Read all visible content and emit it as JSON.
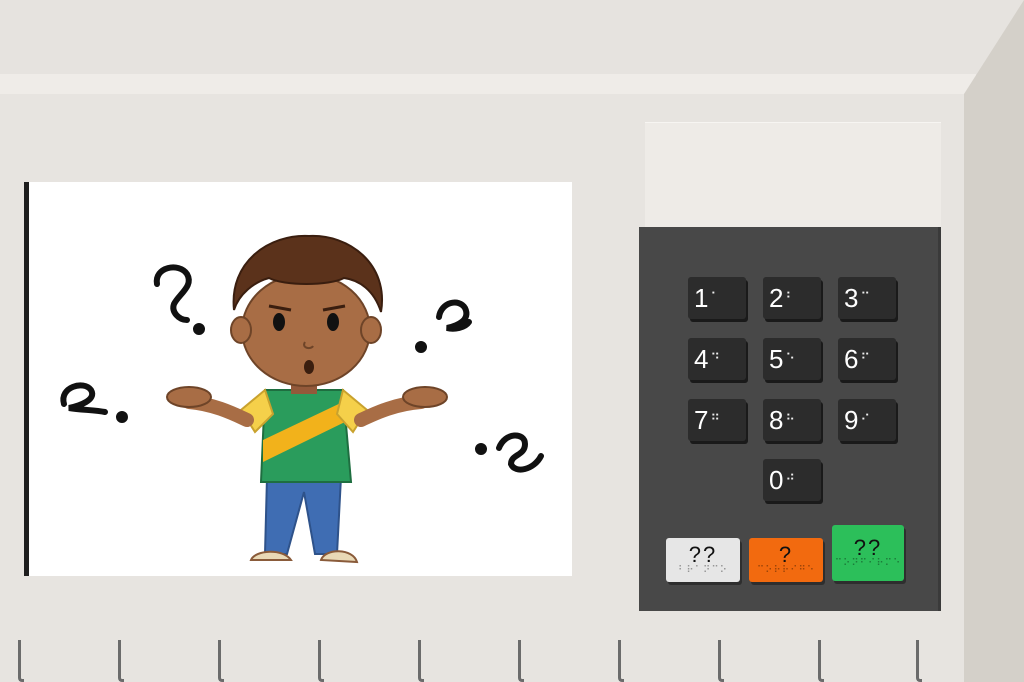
{
  "keypad": {
    "digits": [
      {
        "label": "1",
        "braille": "⠁"
      },
      {
        "label": "2",
        "braille": "⠃"
      },
      {
        "label": "3",
        "braille": "⠉"
      },
      {
        "label": "4",
        "braille": "⠙"
      },
      {
        "label": "5",
        "braille": "⠑"
      },
      {
        "label": "6",
        "braille": "⠋"
      },
      {
        "label": "7",
        "braille": "⠛"
      },
      {
        "label": "8",
        "braille": "⠓"
      },
      {
        "label": "9",
        "braille": "⠊"
      },
      {
        "label": "0",
        "braille": "⠚"
      }
    ],
    "function_keys": [
      {
        "label": "??",
        "color": "#e6e6e6",
        "braille": "⠃⠗⠁⠝⠉⠕"
      },
      {
        "label": "?",
        "color": "#f26a0f",
        "braille": "⠉⠕⠗⠗⠊⠛⠑"
      },
      {
        "label": "??",
        "color": "#2cbf5a",
        "braille": "⠉⠕⠝⠋⠊⠗⠍⠑"
      }
    ]
  },
  "colors": {
    "body": "#e7e4e0",
    "keypad": "#484848",
    "key": "#2c2c2c",
    "shirt": "#2a9c5c",
    "sash": "#f2b21b",
    "sleeve": "#f5d04a",
    "pants": "#3f6db3",
    "skin": "#a86d45",
    "hair": "#5b321b"
  },
  "illustration": {
    "icon": "confused-child-icon",
    "marks_icon": "question-marks-icon"
  }
}
